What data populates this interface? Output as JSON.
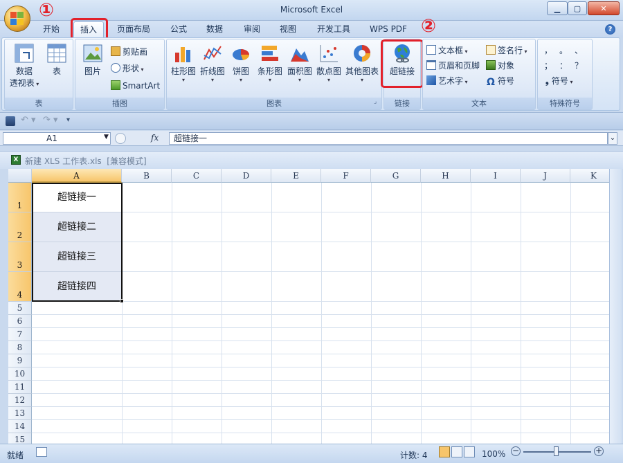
{
  "window": {
    "title": "Microsoft Excel"
  },
  "tabs": [
    "开始",
    "插入",
    "页面布局",
    "公式",
    "数据",
    "审阅",
    "视图",
    "开发工具",
    "WPS PDF"
  ],
  "annotations": {
    "step1": "①",
    "step2": "②"
  },
  "ribbon": {
    "groups": {
      "table": "表",
      "illustrations": "插图",
      "charts": "图表",
      "links": "链接",
      "text": "文本",
      "symbols": "特殊符号"
    },
    "pivot_label_1": "数据",
    "pivot_label_2": "透视表",
    "table_btn": "表",
    "picture_btn": "图片",
    "clipart": "剪贴画",
    "shapes": "形状",
    "smartart": "SmartArt",
    "charts": [
      "柱形图",
      "折线图",
      "饼图",
      "条形图",
      "面积图",
      "散点图",
      "其他图表"
    ],
    "hyperlink": "超链接",
    "textbox": "文本框",
    "header_footer": "页眉和页脚",
    "wordart": "艺术字",
    "signature": "签名行",
    "object": "对象",
    "symbol": "符号",
    "symbol_chars": [
      "，",
      "。",
      "、",
      "；",
      "：",
      "？"
    ],
    "special_symbol": "符号"
  },
  "formula_bar": {
    "name_box": "A1",
    "fx": "fx",
    "content": "超链接一"
  },
  "workbook": {
    "title": "新建 XLS 工作表.xls  [兼容模式]"
  },
  "columns": [
    "A",
    "B",
    "C",
    "D",
    "E",
    "F",
    "G",
    "H",
    "I",
    "J",
    "K"
  ],
  "rows": [
    "1",
    "2",
    "3",
    "4",
    "5",
    "6",
    "7",
    "8",
    "9",
    "10",
    "11",
    "12",
    "13",
    "14",
    "15"
  ],
  "cells": [
    "超链接一",
    "超链接二",
    "超链接三",
    "超链接四"
  ],
  "status": {
    "ready": "就绪",
    "count": "计数: 4",
    "zoom": "100%"
  },
  "colors": {
    "accent_red": "#e2212b",
    "ribbon_bg": "#dfe9f7",
    "selection": "#f7c56b"
  }
}
